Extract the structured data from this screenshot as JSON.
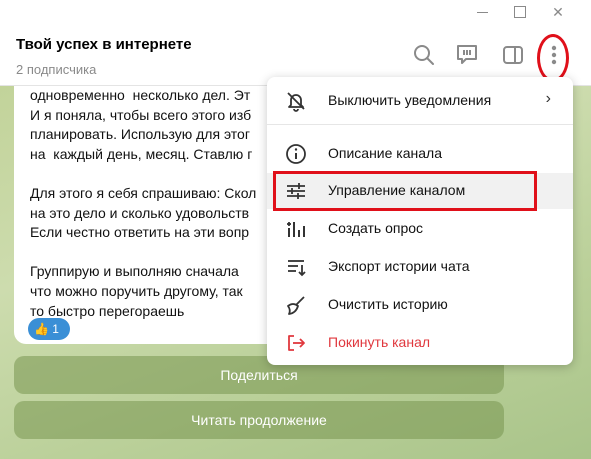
{
  "window": {
    "minimize_icon": "minimize-icon",
    "maximize_icon": "maximize-icon",
    "close_glyph": "✕"
  },
  "header": {
    "title": "Твой успех в интернете",
    "subtitle": "2 подписчика",
    "icons": [
      "search-icon",
      "comments-icon",
      "side-panel-icon",
      "more-vertical-icon"
    ]
  },
  "message": {
    "lines": [
      "одновременно  несколько дел. Эт",
      "И я поняла, чтобы всего этого изб",
      "планировать. Использую для этог",
      "на  каждый день, месяц. Ставлю г",
      "",
      "Для этого я себя спрашиваю: Скол",
      "на это дело и сколько удовольств",
      "Если честно ответить на эти вопр",
      "",
      "Группирую и выполняю сначала",
      "что можно поручить другому, так",
      "то быстро перегораешь"
    ],
    "reaction": {
      "emoji": "👍",
      "count": "1"
    }
  },
  "buttons": {
    "share": "Поделиться",
    "read_more": "Читать продолжение"
  },
  "menu": {
    "items": [
      {
        "label": "Выключить уведомления",
        "icon": "bell-off-icon",
        "has_submenu": true,
        "chevron": "›"
      },
      {
        "label": "Описание канала",
        "icon": "info-icon"
      },
      {
        "label": "Управление каналом",
        "icon": "sliders-icon",
        "highlighted": true
      },
      {
        "label": "Создать опрос",
        "icon": "poll-icon"
      },
      {
        "label": "Экспорт истории чата",
        "icon": "export-icon"
      },
      {
        "label": "Очистить историю",
        "icon": "broom-icon"
      },
      {
        "label": "Покинуть канал",
        "icon": "leave-icon",
        "danger": true
      }
    ]
  },
  "colors": {
    "annotation_red": "#e0101a",
    "danger_text": "#e0383e",
    "reaction_blue": "#3a8fd6",
    "wallpaper_green": "#c2d39a"
  }
}
